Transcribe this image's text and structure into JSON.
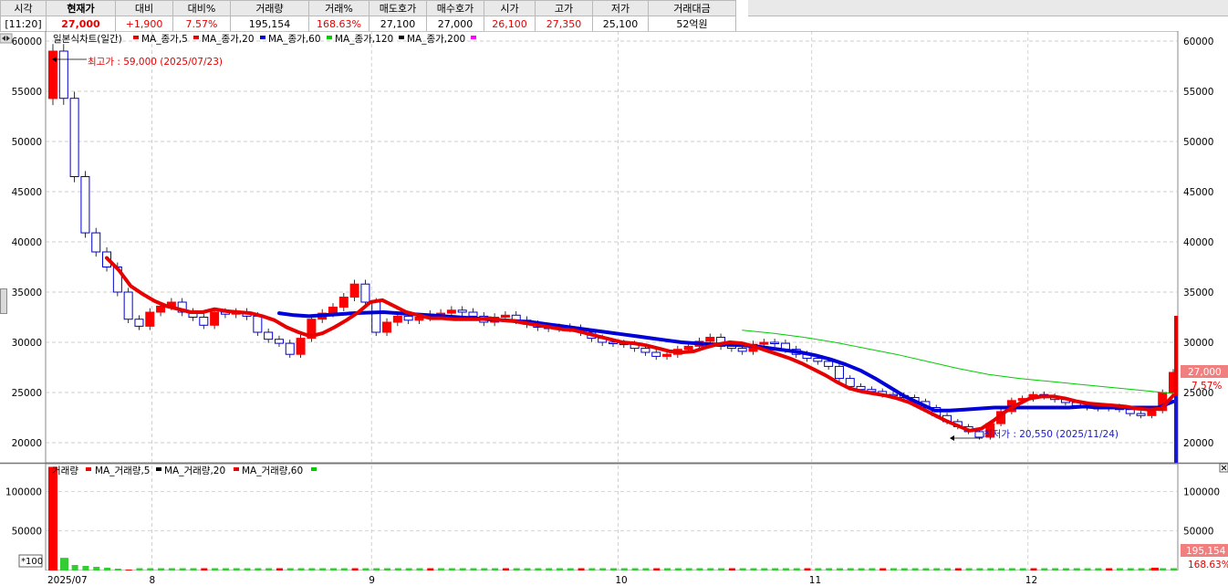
{
  "quote": {
    "headers": [
      "시각",
      "현재가",
      "대비",
      "대비%",
      "거래량",
      "거래%",
      "매도호가",
      "매수호가",
      "시가",
      "고가",
      "저가",
      "거래대금"
    ],
    "values": [
      "[11:20]",
      "27,000",
      "+1,900",
      "7.57%",
      "195,154",
      "168.63%",
      "27,100",
      "27,000",
      "26,100",
      "27,350",
      "25,100",
      "52억원"
    ]
  },
  "price_panel": {
    "legend": [
      "일본식차트(일간)",
      "MA_종가,5",
      "MA_종가,20",
      "MA_종가,60",
      "MA_종가,120",
      "MA_종가,200"
    ],
    "y_ticks": [
      "60000",
      "55000",
      "50000",
      "45000",
      "40000",
      "35000",
      "30000",
      "25000",
      "20000"
    ],
    "high_label": "최고가 : 59,000 (2025/07/23)",
    "low_label": "최저가 : 20,550 (2025/11/24)",
    "current_price_tag": "27,000",
    "current_pct_tag": "7.57%"
  },
  "volume_panel": {
    "legend": [
      "거래량",
      "MA_거래량,5",
      "MA_거래량,20",
      "MA_거래량,60"
    ],
    "y_ticks": [
      "100000",
      "50000"
    ],
    "unit_label": "*100",
    "volume_tag": "195,154",
    "volume_pct_tag": "168.63%"
  },
  "x_axis": {
    "labels": [
      "2025/07",
      "8",
      "9",
      "10",
      "11",
      "12"
    ]
  },
  "colors": {
    "up": "#ff0000",
    "down": "#0000cc",
    "ma5": "#e60000",
    "ma20": "#e60000",
    "ma60": "#0000d8",
    "ma120": "#00cc00",
    "ma200": "#000000",
    "grid": "#bfbfbf"
  },
  "chart_data": {
    "type": "candlestick",
    "title": "일본식차트(일간)",
    "ylim": [
      18000,
      61000
    ],
    "price_marks": [
      59000,
      54300,
      46500,
      40900,
      39000,
      37500,
      35000,
      32300,
      31600,
      33000,
      33600,
      34000,
      33000,
      32500,
      31700,
      33000,
      32800,
      33000,
      32600,
      31000,
      30300,
      29900,
      28800,
      30400,
      32300,
      32900,
      33500,
      34500,
      35800,
      34000,
      31000,
      32000,
      32600,
      32200,
      32500,
      32800,
      32900,
      33200,
      33000,
      32600,
      32000,
      32500,
      32700,
      32200,
      31800,
      31500,
      31400,
      31500,
      31400,
      31000,
      30400,
      30000,
      29900,
      29800,
      29400,
      29000,
      28600,
      28800,
      29300,
      29600,
      30100,
      30500,
      29600,
      29400,
      29100,
      29800,
      30000,
      29900,
      29300,
      28800,
      28400,
      28100,
      27600,
      26400,
      25600,
      25300,
      25100,
      24800,
      24700,
      24500,
      24100,
      23500,
      22700,
      22100,
      21600,
      21100,
      20550,
      21900,
      23100,
      24200,
      24400,
      24800,
      24600,
      24300,
      24000,
      23700,
      23500,
      23400,
      23600,
      23300,
      22900,
      22700,
      23200,
      25000,
      27000
    ],
    "ma5": [
      38400,
      37200,
      35600,
      34800,
      34100,
      33600,
      33300,
      33000,
      33000,
      33300,
      33100,
      33000,
      32900,
      32600,
      32200,
      31500,
      31000,
      30600,
      30900,
      31500,
      32200,
      33000,
      34000,
      34200,
      33600,
      33000,
      32700,
      32400,
      32400,
      32300,
      32300,
      32300,
      32400,
      32200,
      32100,
      31900,
      31700,
      31500,
      31300,
      31200,
      30900,
      30600,
      30300,
      30000,
      29900,
      29700,
      29400,
      29100,
      29000,
      29100,
      29500,
      29800,
      30000,
      29900,
      29600,
      29200,
      28800,
      28400,
      27900,
      27300,
      26700,
      26000,
      25400,
      25100,
      24900,
      24700,
      24400,
      24000,
      23400,
      22800,
      22200,
      21700,
      21200,
      21400,
      22200,
      23100,
      23800,
      24400,
      24600,
      24600,
      24400,
      24100,
      23900,
      23800,
      23700,
      23600,
      23400,
      23300,
      23400,
      24700
    ],
    "ma60": [
      32900,
      32700,
      32600,
      32700,
      32800,
      32900,
      32950,
      33000,
      32900,
      32800,
      32700,
      32600,
      32500,
      32400,
      32300,
      32200,
      32100,
      32000,
      31800,
      31600,
      31400,
      31200,
      31000,
      30800,
      30600,
      30400,
      30200,
      30000,
      29900,
      29800,
      29800,
      29700,
      29600,
      29400,
      29200,
      29000,
      28700,
      28300,
      27800,
      27200,
      26400,
      25500,
      24600,
      23900,
      23200,
      23200,
      23300,
      23400,
      23500,
      23500,
      23500,
      23500,
      23500,
      23500,
      23600,
      23500,
      23500,
      23500,
      23500,
      23500,
      24100
    ],
    "ma120": [
      31200,
      30900,
      30500,
      30000,
      29400,
      28800,
      28100,
      27400,
      26800,
      26400,
      26100,
      25800,
      25500,
      25200,
      24900
    ],
    "volume_scale_ylim": [
      0,
      135000
    ],
    "volume_first_bar": 131000,
    "volume_second_bar": 16000
  }
}
